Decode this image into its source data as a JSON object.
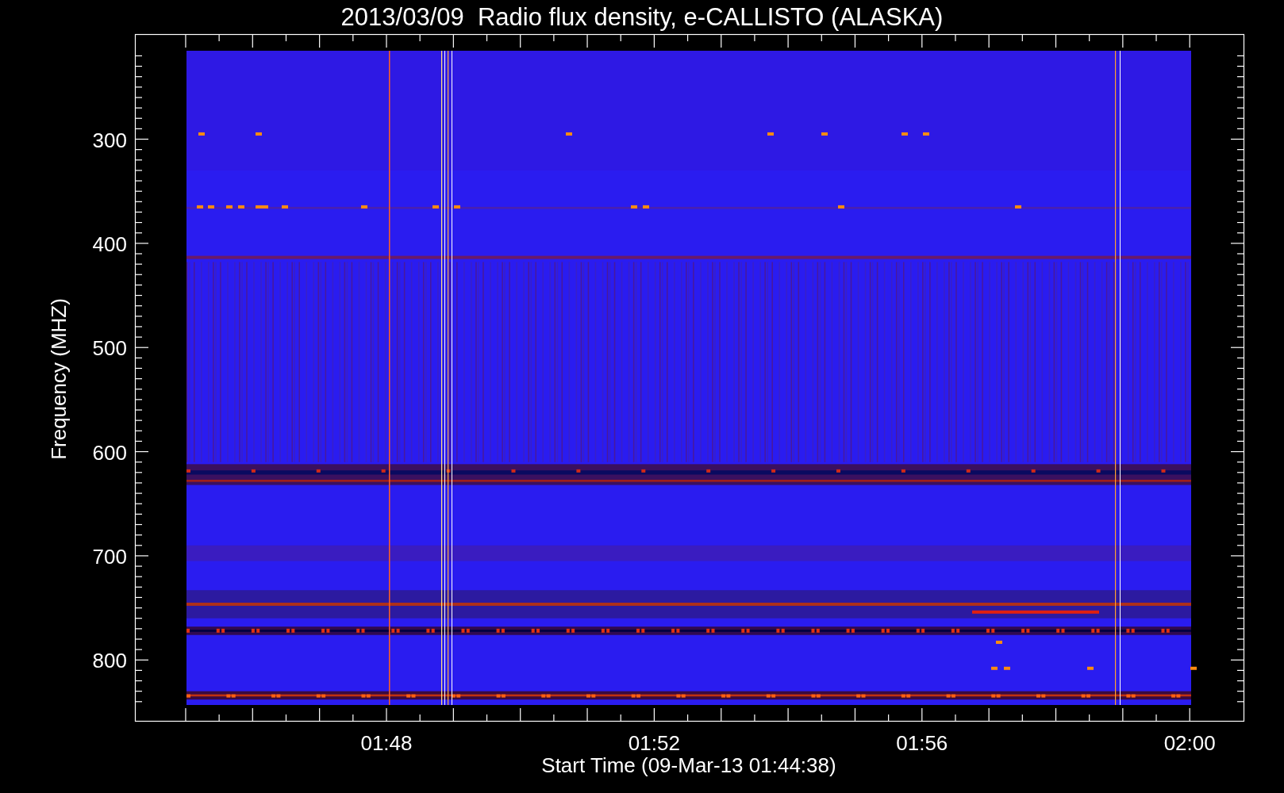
{
  "plot": {
    "title": "2013/03/09  Radio flux density, e-CALLISTO (ALASKA)",
    "ylabel": "Frequency (MHZ)",
    "xlabel": "Start Time (09-Mar-13 01:44:38)",
    "y_tick_labels": [
      "300",
      "400",
      "500",
      "600",
      "700",
      "800"
    ],
    "x_tick_labels": [
      "01:48",
      "01:52",
      "01:56",
      "02:00"
    ]
  }
}
